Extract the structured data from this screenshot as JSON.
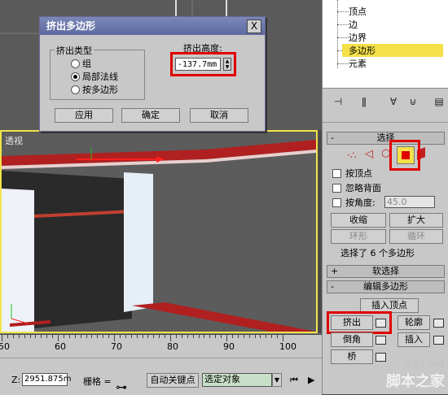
{
  "dialog": {
    "title": "挤出多边形",
    "close_label": "X",
    "group_label": "挤出类型",
    "options": [
      {
        "label": "组",
        "selected": false
      },
      {
        "label": "局部法线",
        "selected": true
      },
      {
        "label": "按多边形",
        "selected": false
      }
    ],
    "height_label": "挤出高度:",
    "height_value": "-137.7mm",
    "buttons": {
      "apply": "应用",
      "ok": "确定",
      "cancel": "取消"
    }
  },
  "viewport": {
    "label": "透视"
  },
  "tree": {
    "items": [
      "顶点",
      "边",
      "边界",
      "多边形",
      "元素"
    ],
    "selected": "多边形"
  },
  "selection_rollout": {
    "title": "选择",
    "sign": "-",
    "by_vertex": "按顶点",
    "ignore_backfacing": "忽略背面",
    "by_angle": "按角度:",
    "angle_value": "45.0",
    "shrink": "收缩",
    "grow": "扩大",
    "ring": "环形",
    "loop": "循环",
    "status": "选择了 6 个多边形"
  },
  "soft_selection": {
    "title": "软选择",
    "sign": "+"
  },
  "edit_polygons": {
    "title": "编辑多边形",
    "sign": "-",
    "insert_vertex": "插入顶点",
    "extrude": "挤出",
    "outline": "轮廓",
    "bevel": "倒角",
    "inset": "插入",
    "bridge": "桥"
  },
  "timeline": {
    "ticks": [
      "50",
      "60",
      "70",
      "80",
      "90",
      "100"
    ]
  },
  "statusbar": {
    "z_label": "Z:",
    "z_value": "2951.875m",
    "grid_label": "栅格 =",
    "auto_key": "自动关键点",
    "selected_object": "选定对象"
  },
  "watermark": {
    "line1": "jb51.net",
    "line2": "脚本之家"
  },
  "colors": {
    "highlight": "#e00000",
    "selection_yellow": "#f5e04a",
    "accent_red": "#c02020"
  }
}
